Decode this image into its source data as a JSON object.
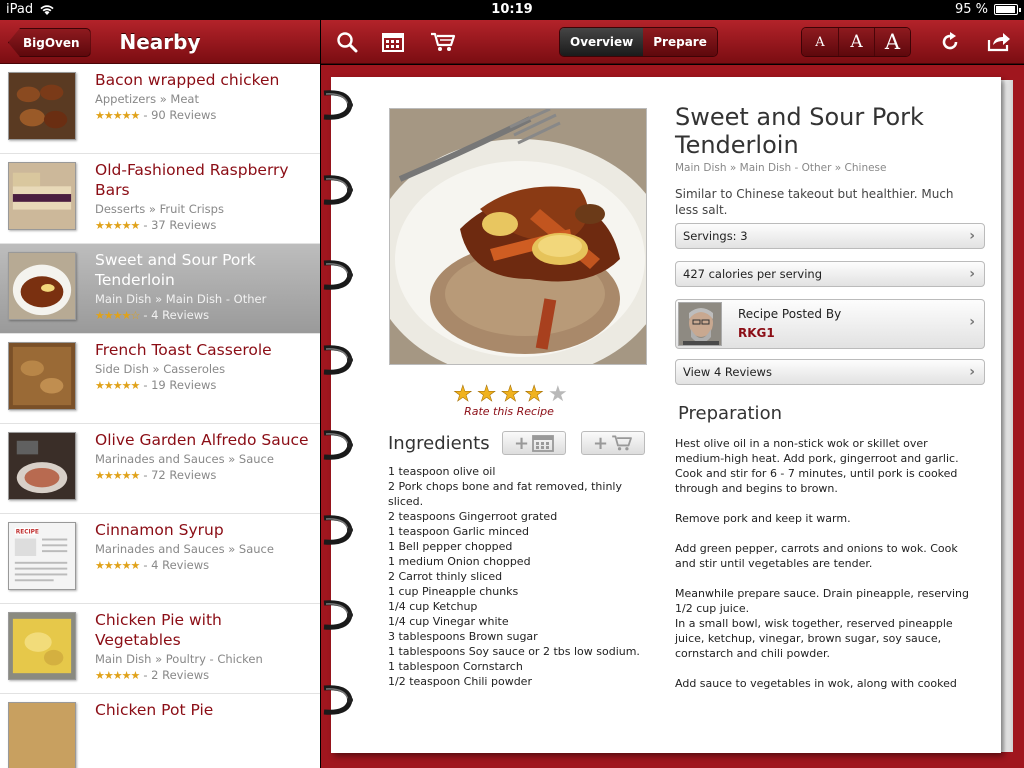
{
  "status": {
    "carrier": "iPad",
    "time": "10:19",
    "battery": "95 %",
    "battery_level": 0.95
  },
  "nav": {
    "back_label": "BigOven",
    "title": "Nearby"
  },
  "list": [
    {
      "name": "Bacon wrapped chicken",
      "category": "Appetizers » Meat",
      "stars": "★★★★★",
      "reviews": "- 90 Reviews",
      "selected": false
    },
    {
      "name": "Old-Fashioned Raspberry Bars",
      "category": "Desserts » Fruit Crisps",
      "stars": "★★★★★",
      "reviews": "- 37 Reviews",
      "selected": false
    },
    {
      "name": "Sweet and Sour Pork Tenderloin",
      "category": "Main Dish » Main Dish - Other",
      "stars": "★★★★☆",
      "reviews": "- 4 Reviews",
      "selected": true
    },
    {
      "name": "French Toast Casserole",
      "category": "Side Dish » Casseroles",
      "stars": "★★★★★",
      "reviews": "- 19 Reviews",
      "selected": false
    },
    {
      "name": "Olive Garden Alfredo Sauce",
      "category": "Marinades and Sauces » Sauce",
      "stars": "★★★★★",
      "reviews": "- 72 Reviews",
      "selected": false
    },
    {
      "name": "Cinnamon Syrup",
      "category": "Marinades and Sauces » Sauce",
      "stars": "★★★★★",
      "reviews": "- 4 Reviews",
      "selected": false
    },
    {
      "name": "Chicken Pie with Vegetables",
      "category": "Main Dish » Poultry - Chicken",
      "stars": "★★★★★",
      "reviews": "- 2 Reviews",
      "selected": false
    },
    {
      "name": "Chicken Pot Pie",
      "category": "",
      "stars": "",
      "reviews": "",
      "selected": false
    }
  ],
  "toolbar": {
    "tabs": [
      "Overview",
      "Prepare"
    ],
    "active_tab": "Overview",
    "font_sizes": [
      "A",
      "A",
      "A"
    ]
  },
  "recipe": {
    "title": "Sweet and Sour Pork Tenderloin",
    "breadcrumb": "Main Dish » Main Dish - Other » Chinese",
    "description": "Similar to Chinese takeout but healthier.  Much less salt.",
    "servings": "Servings: 3",
    "calories": "427 calories per serving",
    "posted_by_label": "Recipe Posted By",
    "posted_by_user": "RKG1",
    "reviews_label": "View 4 Reviews",
    "rating": 4,
    "rating_max": 5,
    "rate_label": "Rate this Recipe",
    "ingredients_title": "Ingredients",
    "ingredients": [
      "1 teaspoon olive oil",
      "2 Pork chops bone and fat removed, thinly sliced.",
      "2 teaspoons Gingerroot grated",
      "1 teaspoon Garlic minced",
      "1 Bell pepper chopped",
      "1 medium Onion chopped",
      "2 Carrot thinly sliced",
      "1 cup Pineapple chunks",
      "1/4 cup Ketchup",
      "1/4 cup Vinegar white",
      "3 tablespoons Brown sugar",
      "1 tablespoons Soy sauce or 2 tbs low sodium.",
      "1 tablespoon Cornstarch",
      "1/2 teaspoon Chili powder"
    ],
    "preparation_title": "Preparation",
    "preparation": [
      "Hest olive oil in a non-stick wok or skillet over medium-high heat.  Add pork, gingerroot and garlic.  Cook and stir for 6 - 7 minutes, until pork is cooked through and begins to brown.",
      "Remove pork and keep it warm.",
      "Add green pepper, carrots and onions to wok.  Cook and stir until vegetables are tender.",
      "Meanwhile prepare sauce.  Drain pineapple, reserving 1/2 cup juice.",
      "In a small bowl, wisk together, reserved pineapple juice, ketchup, vinegar, brown sugar, soy sauce, cornstarch and chili powder.",
      "Add sauce to vegetables in wok, along with cooked"
    ]
  },
  "icons": {
    "search": "search-icon",
    "calendar": "calendar-icon",
    "cart": "cart-icon",
    "refresh": "refresh-icon",
    "share": "share-icon"
  },
  "colors": {
    "brand_red": "#9e1219",
    "title_red": "#8b0d15",
    "star_gold": "#f0b21f"
  }
}
